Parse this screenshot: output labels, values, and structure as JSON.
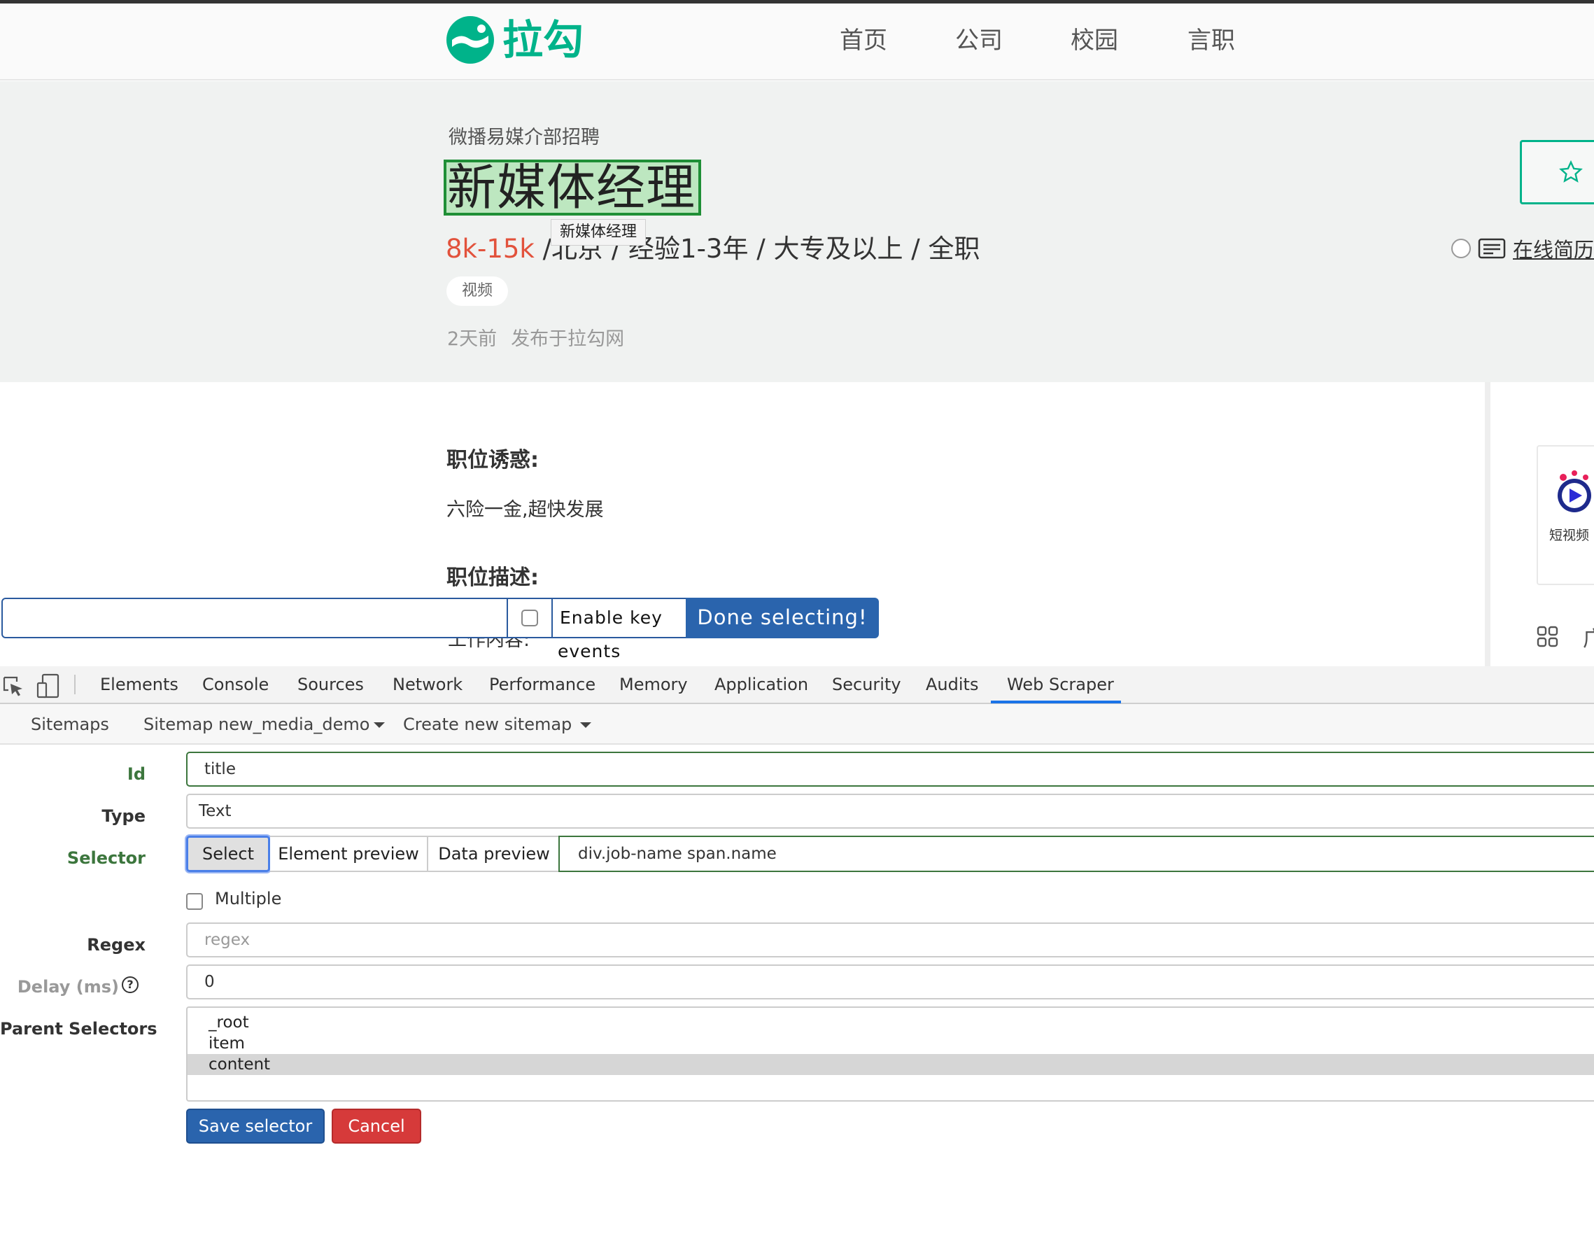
{
  "site": {
    "logo_text": "拉勾",
    "nav": [
      "首页",
      "公司",
      "校园",
      "言职"
    ],
    "accent_color": "#00b38a"
  },
  "job": {
    "company_dept": "微播易媒介部招聘",
    "title": "新媒体经理",
    "title_tooltip": "新媒体经理",
    "salary": "8k-15k",
    "meta": " /北京 / 经验1-3年 / 大专及以上 / 全职",
    "tag": "视频",
    "posted_time": "2天前",
    "posted_source": "发布于拉勾网",
    "salary_color": "#e2523c"
  },
  "side": {
    "resume_label": "在线简历",
    "ad_label": "短视频",
    "bottom_text": "广"
  },
  "content": {
    "benefits_heading": "职位诱惑:",
    "benefits_text": "六险一金,超快发展",
    "description_heading": "职位描述:",
    "partial_text": "工作内容:"
  },
  "select_bar": {
    "selected_value": "",
    "enable_key_label": "Enable key",
    "enable_key_overflow": "events",
    "done_label": "Done selecting!"
  },
  "devtools": {
    "tabs": [
      "Elements",
      "Console",
      "Sources",
      "Network",
      "Performance",
      "Memory",
      "Application",
      "Security",
      "Audits",
      "Web Scraper"
    ],
    "active_tab": "Web Scraper"
  },
  "scraper": {
    "nav": {
      "sitemaps": "Sitemaps",
      "sitemap_current": "Sitemap new_media_demo",
      "create": "Create new sitemap"
    },
    "form": {
      "id_label": "Id",
      "id_value": "title",
      "type_label": "Type",
      "type_value": "Text",
      "selector_label": "Selector",
      "select_button": "Select",
      "element_preview_button": "Element preview",
      "data_preview_button": "Data preview",
      "selector_value": "div.job-name span.name",
      "multiple_label": "Multiple",
      "regex_label": "Regex",
      "regex_placeholder": "regex",
      "delay_label": "Delay (ms)",
      "delay_value": "0",
      "parent_label": "Parent Selectors",
      "parent_options": [
        "_root",
        "item",
        "content"
      ],
      "parent_selected": "content",
      "save_button": "Save selector",
      "cancel_button": "Cancel"
    }
  }
}
